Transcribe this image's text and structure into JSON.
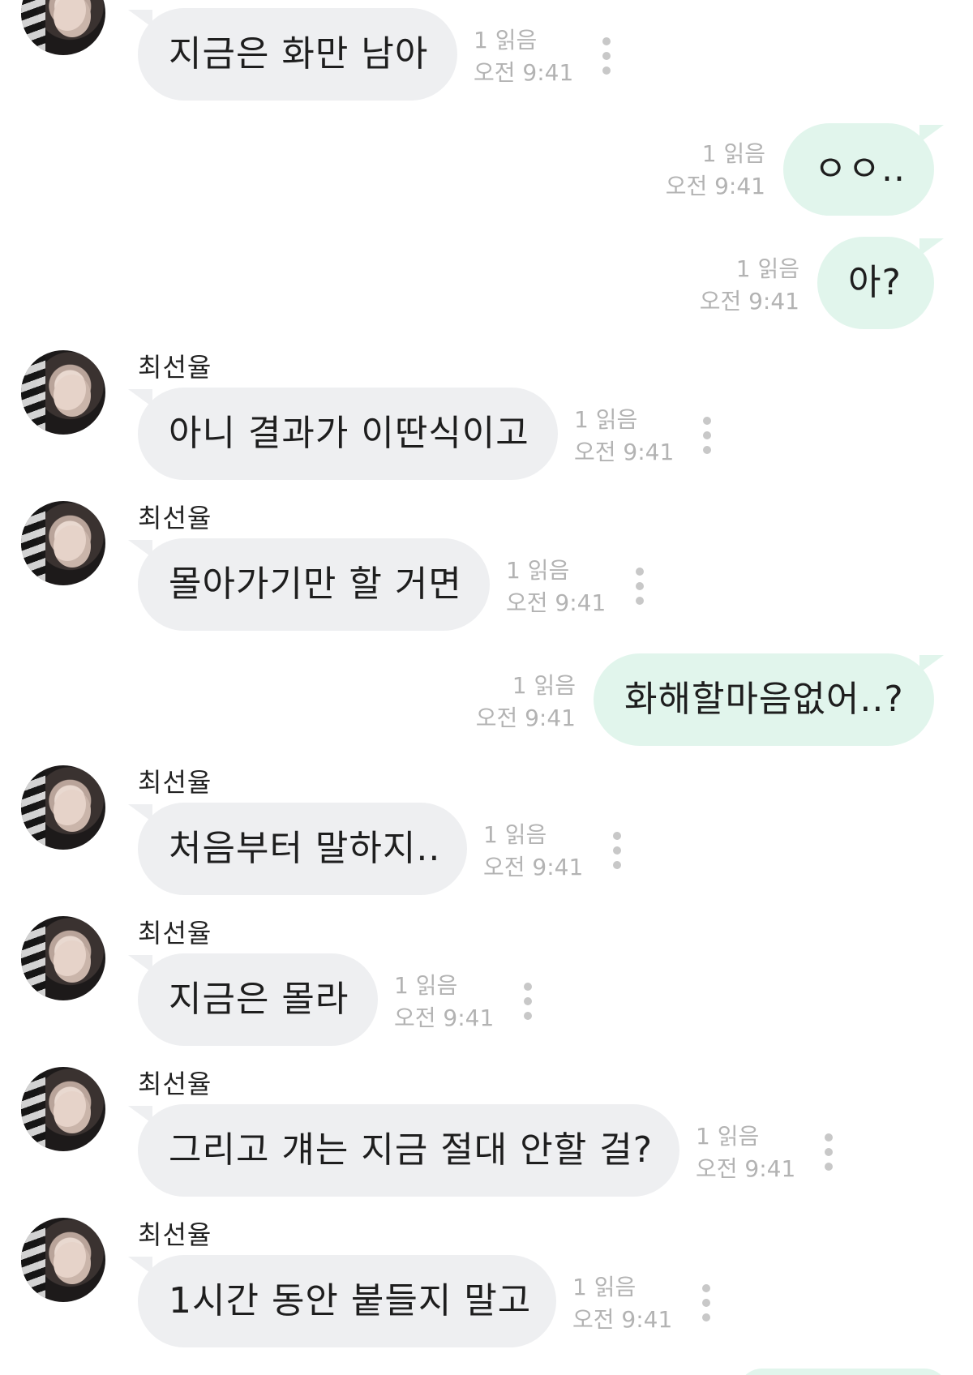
{
  "sender_name": "최선율",
  "messages": [
    {
      "dir": "in",
      "text": "지금은 화만 남아",
      "read": "1 읽음",
      "time": "오전 9:41",
      "show_name": false
    },
    {
      "dir": "out",
      "text": "ㅇㅇ..",
      "read": "1 읽음",
      "time": "오전 9:41"
    },
    {
      "dir": "out",
      "text": "아?",
      "read": "1 읽음",
      "time": "오전 9:41"
    },
    {
      "dir": "in",
      "text": "아니 결과가 이딴식이고",
      "read": "1 읽음",
      "time": "오전 9:41",
      "show_name": true
    },
    {
      "dir": "in",
      "text": "몰아가기만 할 거면",
      "read": "1 읽음",
      "time": "오전 9:41",
      "show_name": true
    },
    {
      "dir": "out",
      "text": "화해할마음없어..?",
      "read": "1 읽음",
      "time": "오전 9:41"
    },
    {
      "dir": "in",
      "text": "처음부터 말하지..",
      "read": "1 읽음",
      "time": "오전 9:41",
      "show_name": true
    },
    {
      "dir": "in",
      "text": "지금은 몰라",
      "read": "1 읽음",
      "time": "오전 9:41",
      "show_name": true
    },
    {
      "dir": "in",
      "text": "그리고 걔는 지금 절대 안할 걸?",
      "read": "1 읽음",
      "time": "오전 9:41",
      "show_name": true
    },
    {
      "dir": "in",
      "text": "1시간 동안 붙들지 말고",
      "read": "1 읽음",
      "time": "오전 9:41",
      "show_name": true
    }
  ],
  "colors": {
    "incoming_bubble": "#eeeff1",
    "outgoing_bubble": "#e1f5ec",
    "meta_text": "#b3b3b3"
  },
  "icons": {
    "more": "more-vertical-icon",
    "avatar": "avatar"
  }
}
